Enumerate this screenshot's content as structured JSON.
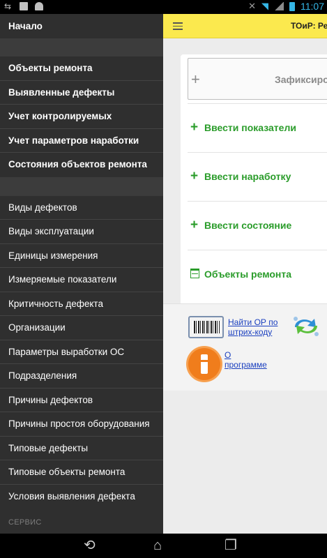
{
  "status_bar": {
    "time": "11:07",
    "icons": [
      "usb-icon",
      "image-icon",
      "android-icon",
      "mute-icon",
      "wifi-icon",
      "signal-icon",
      "battery-icon"
    ]
  },
  "sidebar": {
    "home": "Начало",
    "group1": [
      "Объекты ремонта",
      "Выявленные дефекты",
      "Учет контролируемых",
      "Учет параметров наработки",
      "Состояния объектов ремонта"
    ],
    "group2": [
      "Виды дефектов",
      "Виды эксплуатации",
      "Единицы измерения",
      "Измеряемые показатели",
      "Критичность дефекта",
      "Организации",
      "Параметры выработки ОС",
      "Подразделения",
      "Причины дефектов",
      "Причины простоя оборудования",
      "Типовые дефекты",
      "Типовые объекты ремонта",
      "Условия выявления дефекта"
    ],
    "section_service": "СЕРВИС"
  },
  "header": {
    "title": "ТОиР: Рем",
    "accent_color": "#fbe94e"
  },
  "main": {
    "fix_button": "Зафиксиро",
    "actions": [
      {
        "icon": "plus-icon",
        "label": "Ввести показатели"
      },
      {
        "icon": "plus-icon",
        "label": "Ввести наработку"
      },
      {
        "icon": "plus-icon",
        "label": "Ввести состояние"
      },
      {
        "icon": "table-icon",
        "label": "Объекты ремонта"
      }
    ],
    "links": {
      "barcode_line1": "Найти ОР по",
      "barcode_line2": "штрих-коду",
      "about_line1": "О",
      "about_line2": "программе"
    },
    "action_color": "#2a9c2a"
  }
}
